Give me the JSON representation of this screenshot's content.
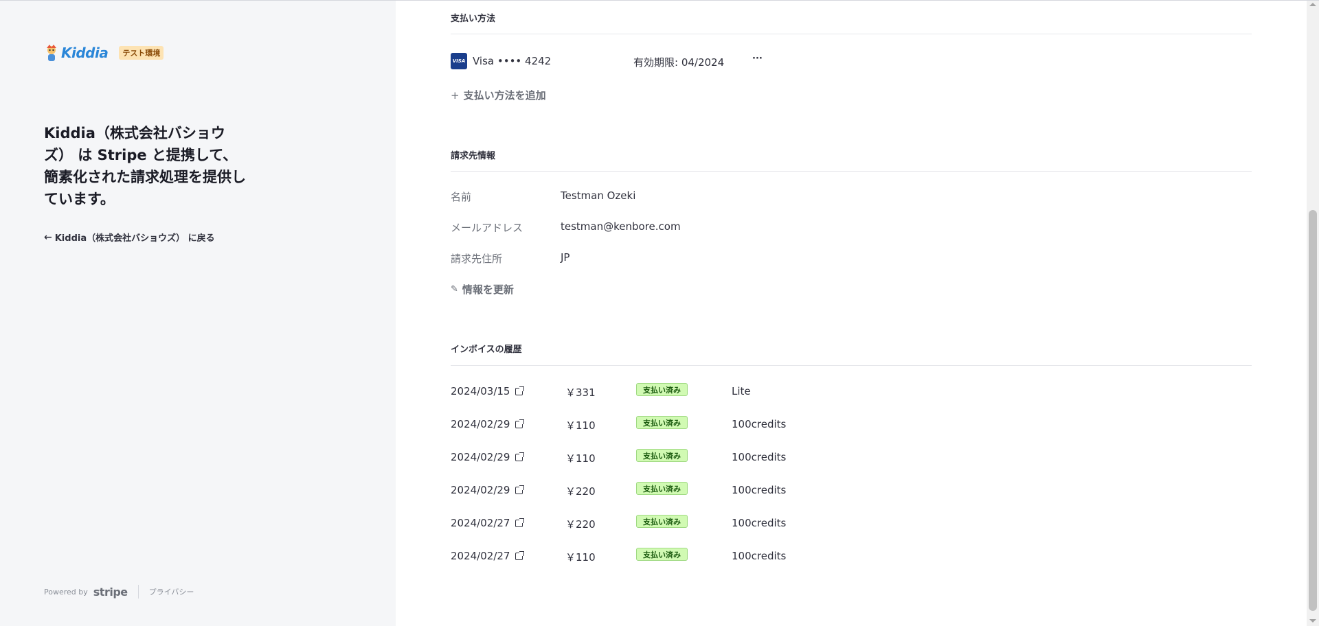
{
  "sidebar": {
    "logo_text": "Kiddia",
    "test_badge": "テスト環境",
    "headline": "Kiddia（株式会社バショウズ） は Stripe と提携して、簡素化された請求処理を提供しています。",
    "back_link": "Kiddia（株式会社バショウズ） に戻る",
    "powered_by": "Powered by",
    "stripe_word": "stripe",
    "privacy": "プライバシー"
  },
  "payment_methods": {
    "title": "支払い方法",
    "card_brand_badge": "VISA",
    "card_label": "Visa •••• 4242",
    "expiry": "有効期限: 04/2024",
    "more": "···",
    "add_label": "支払い方法を追加"
  },
  "billing_info": {
    "title": "請求先情報",
    "rows": [
      {
        "label": "名前",
        "value": "Testman Ozeki"
      },
      {
        "label": "メールアドレス",
        "value": "testman@kenbore.com"
      },
      {
        "label": "請求先住所",
        "value": "JP"
      }
    ],
    "update_label": "情報を更新"
  },
  "invoice_history": {
    "title": "インボイスの履歴",
    "invoices": [
      {
        "date": "2024/03/15",
        "amount": "￥331",
        "status": "支払い済み",
        "description": "Lite"
      },
      {
        "date": "2024/02/29",
        "amount": "￥110",
        "status": "支払い済み",
        "description": "100credits"
      },
      {
        "date": "2024/02/29",
        "amount": "￥110",
        "status": "支払い済み",
        "description": "100credits"
      },
      {
        "date": "2024/02/29",
        "amount": "￥220",
        "status": "支払い済み",
        "description": "100credits"
      },
      {
        "date": "2024/02/27",
        "amount": "￥220",
        "status": "支払い済み",
        "description": "100credits"
      },
      {
        "date": "2024/02/27",
        "amount": "￥110",
        "status": "支払い済み",
        "description": "100credits"
      }
    ]
  },
  "icons": {
    "back": "arrow-left-icon",
    "add": "plus-icon",
    "edit": "edit-icon",
    "external": "external-link-icon"
  },
  "colors": {
    "brand": "#2a86d8",
    "paid_badge_bg": "#d1fab3",
    "test_badge_bg": "#fde3b3",
    "visa": "#1a3e8c"
  }
}
